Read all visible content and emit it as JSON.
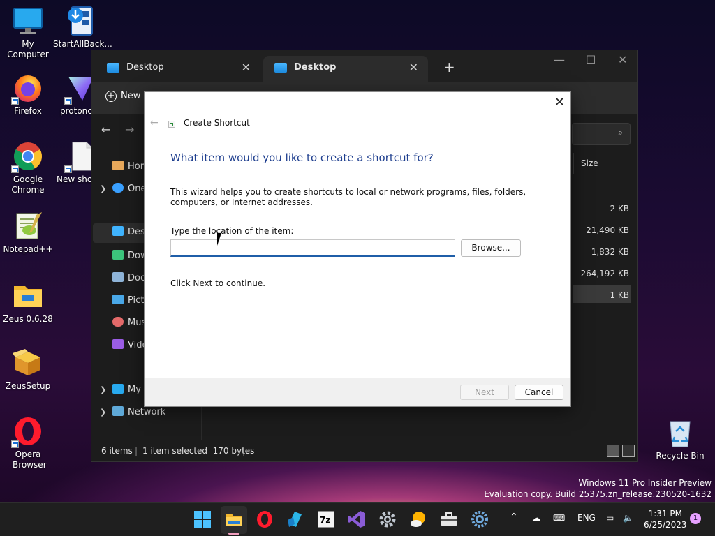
{
  "desktop": {
    "icons": [
      {
        "label": "My Computer"
      },
      {
        "label": "StartAllBack..."
      },
      {
        "label": "Firefox"
      },
      {
        "label": "protoncl"
      },
      {
        "label": "Google Chrome"
      },
      {
        "label": "New shor"
      },
      {
        "label": "Notepad++"
      },
      {
        "label": "Zeus 0.6.28"
      },
      {
        "label": "ZeusSetup"
      },
      {
        "label": "Opera Browser"
      },
      {
        "label": "Recycle Bin"
      }
    ]
  },
  "explorer": {
    "tabs": [
      {
        "label": "Desktop",
        "icon": "folder-desktop-icon"
      },
      {
        "label": "Desktop",
        "icon": "folder-desktop-icon"
      }
    ],
    "new_label": "New",
    "sidebar": [
      {
        "label": "Hor"
      },
      {
        "label": "One"
      },
      {
        "label": "Desk"
      },
      {
        "label": "Dow"
      },
      {
        "label": "Doc"
      },
      {
        "label": "Pict"
      },
      {
        "label": "Mus"
      },
      {
        "label": "Vide"
      },
      {
        "label": "My"
      },
      {
        "label": "Network"
      }
    ],
    "column_header": "Size",
    "sizes": [
      "2 KB",
      "21,490 KB",
      "1,832 KB",
      "264,192 KB",
      "1 KB"
    ],
    "status": {
      "items": "6 items",
      "selected": "1 item selected  170 bytes"
    }
  },
  "dialog": {
    "title": "Create Shortcut",
    "heading": "What item would you like to create a shortcut for?",
    "description": "This wizard helps you to create shortcuts to local or network programs, files, folders, computers, or Internet addresses.",
    "location_label": "Type the location of the item:",
    "location_value": "",
    "browse_label": "Browse...",
    "hint": "Click Next to continue.",
    "next_label": "Next",
    "cancel_label": "Cancel"
  },
  "watermark": {
    "line1": "Windows 11 Pro Insider Preview",
    "line2": "Evaluation copy. Build 25375.zn_release.230520-1632"
  },
  "taskbar": {
    "language": "ENG",
    "time": "1:31 PM",
    "date": "6/25/2023",
    "notification_count": "1"
  },
  "colors": {
    "dialog_heading": "#1f3f8f",
    "input_focus": "#1f5ea8",
    "explorer_bg": "#1c1c1c"
  }
}
